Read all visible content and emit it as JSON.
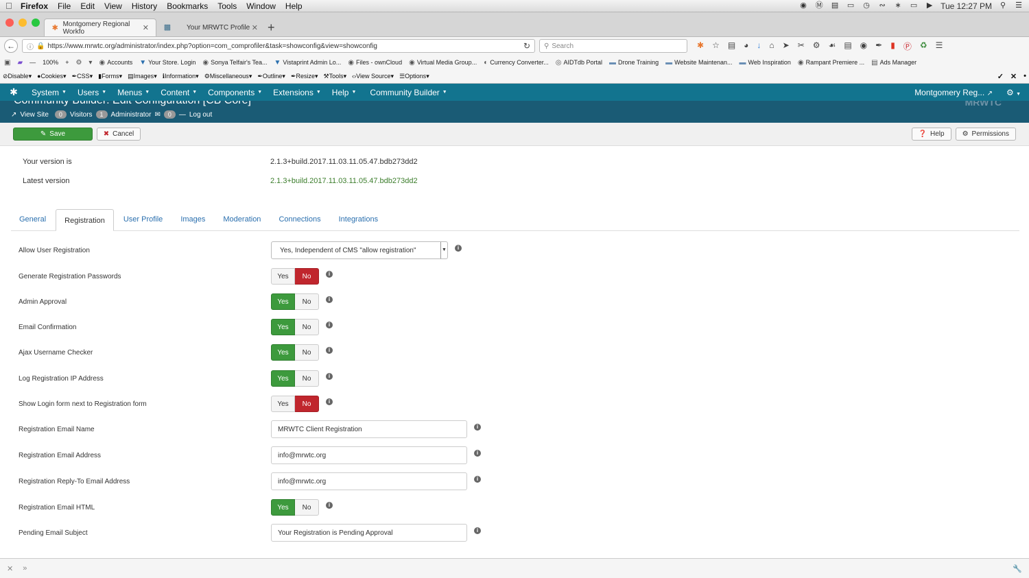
{
  "menubar": {
    "items": [
      "Firefox",
      "File",
      "Edit",
      "View",
      "History",
      "Bookmarks",
      "Tools",
      "Window",
      "Help"
    ],
    "clock": "Tue 12:27 PM"
  },
  "browser": {
    "tabs": [
      {
        "title": "Montgomery Regional Workfo"
      },
      {
        "title": "Your MRWTC Profile"
      }
    ],
    "url": "https://www.mrwtc.org/administrator/index.php?option=com_comprofiler&task=showconfig&view=showconfig",
    "search_placeholder": "Search",
    "zoom": "100%",
    "bookmarks": [
      "Accounts",
      "Your Store. Login",
      "Sonya Telfair's Tea...",
      "Vistaprint Admin Lo...",
      "Files - ownCloud",
      "Virtual Media Group...",
      "Currency Converter...",
      "AIDTdb Portal",
      "Drone Training",
      "Website Maintenan...",
      "Web Inspiration",
      "Rampant Premiere ...",
      "Ads Manager"
    ],
    "devtools": [
      "Disable",
      "Cookies",
      "CSS",
      "Forms",
      "Images",
      "Information",
      "Miscellaneous",
      "Outline",
      "Resize",
      "Tools",
      "View Source",
      "Options"
    ]
  },
  "joomla": {
    "nav": [
      "System",
      "Users",
      "Menus",
      "Content",
      "Components",
      "Extensions",
      "Help",
      "Community Builder"
    ],
    "site_name": "Montgomery Reg...",
    "page_title": "Community Builder: Edit Configuration [CB Core]",
    "status": {
      "view_site": "View Site",
      "visitors_count": "0",
      "visitors_label": "Visitors",
      "admin_count": "1",
      "admin_label": "Administrator",
      "msg_count": "0",
      "logout": "Log out"
    },
    "toolbar": {
      "save": "Save",
      "cancel": "Cancel",
      "help": "Help",
      "permissions": "Permissions"
    }
  },
  "versions": {
    "your_label": "Your version is",
    "your_value": "2.1.3+build.2017.11.03.11.05.47.bdb273dd2",
    "latest_label": "Latest version",
    "latest_value": "2.1.3+build.2017.11.03.11.05.47.bdb273dd2"
  },
  "config_tabs": [
    "General",
    "Registration",
    "User Profile",
    "Images",
    "Moderation",
    "Connections",
    "Integrations"
  ],
  "toggle_labels": {
    "yes": "Yes",
    "no": "No"
  },
  "fields": [
    {
      "label": "Allow User Registration",
      "type": "select",
      "value": "Yes, Independent of CMS \"allow registration\""
    },
    {
      "label": "Generate Registration Passwords",
      "type": "toggle",
      "value": "No"
    },
    {
      "label": "Admin Approval",
      "type": "toggle",
      "value": "Yes"
    },
    {
      "label": "Email Confirmation",
      "type": "toggle",
      "value": "Yes"
    },
    {
      "label": "Ajax Username Checker",
      "type": "toggle",
      "value": "Yes"
    },
    {
      "label": "Log Registration IP Address",
      "type": "toggle",
      "value": "Yes"
    },
    {
      "label": "Show Login form next to Registration form",
      "type": "toggle",
      "value": "No"
    },
    {
      "label": "Registration Email Name",
      "type": "text",
      "value": "MRWTC Client Registration"
    },
    {
      "label": "Registration Email Address",
      "type": "text",
      "value": "info@mrwtc.org"
    },
    {
      "label": "Registration Reply-To Email Address",
      "type": "text",
      "value": "info@mrwtc.org"
    },
    {
      "label": "Registration Email HTML",
      "type": "toggle",
      "value": "Yes"
    },
    {
      "label": "Pending Email Subject",
      "type": "text",
      "value": "Your Registration is Pending Approval"
    }
  ]
}
